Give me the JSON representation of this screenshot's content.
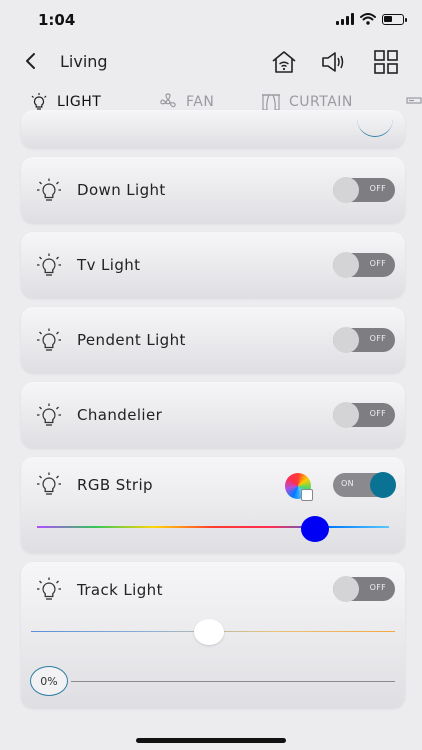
{
  "status": {
    "time": "1:04",
    "battery_level": 0.45
  },
  "header": {
    "title": "Living"
  },
  "tabs": [
    {
      "label": "LIGHT",
      "icon": "bulb-icon",
      "active": true
    },
    {
      "label": "FAN",
      "icon": "fan-icon",
      "active": false
    },
    {
      "label": "CURTAIN",
      "icon": "curtain-icon",
      "active": false
    }
  ],
  "lights": [
    {
      "name": "Down Light",
      "state": "OFF"
    },
    {
      "name": "Tv Light",
      "state": "OFF"
    },
    {
      "name": "Pendent Light",
      "state": "OFF"
    },
    {
      "name": "Chandelier",
      "state": "OFF"
    },
    {
      "name": "RGB Strip",
      "state": "ON",
      "color_level": 0.79,
      "thumb_color": "#0000f5"
    },
    {
      "name": "Track Light",
      "state": "OFF",
      "brightness_level": 0.49,
      "level_label": "0%"
    }
  ],
  "colors": {
    "accent": "#0a7394",
    "toggle_off": "#7e7e82",
    "rgb_thumb": "#0000f5"
  }
}
